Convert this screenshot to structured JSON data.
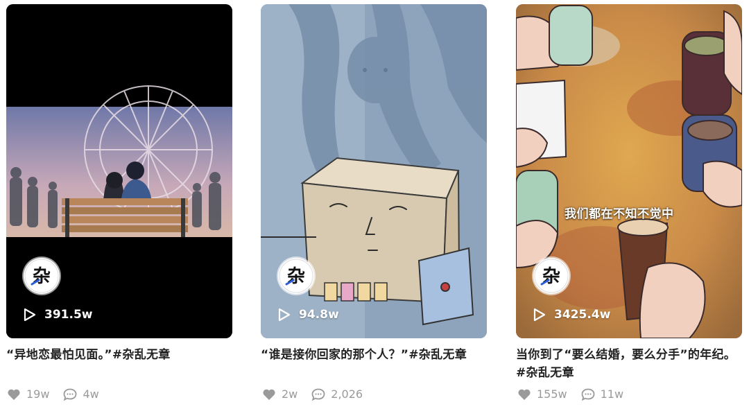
{
  "cards": [
    {
      "plays": "391.5w",
      "title": "“异地恋最怕见面。”#杂乱无章",
      "likes": "19w",
      "comments": "4w",
      "avatar_glyph": "杂",
      "thumbnail": "ferris-wheel-couple-scene"
    },
    {
      "plays": "94.8w",
      "title": "“谁是接你回家的那个人？”#杂乱无章",
      "likes": "2w",
      "comments": "2,026",
      "avatar_glyph": "杂",
      "thumbnail": "sad-cardboard-box-character"
    },
    {
      "plays": "3425.4w",
      "title": "当你到了“要么结婚，要么分手”的年纪。#杂乱无章",
      "likes": "155w",
      "comments": "11w",
      "avatar_glyph": "杂",
      "thumbnail": "friends-toasting-drinks",
      "overlay_caption": "我们都在不知不觉中"
    }
  ],
  "icons": {
    "play": "play-icon",
    "like": "heart-icon",
    "comment": "comment-icon"
  }
}
